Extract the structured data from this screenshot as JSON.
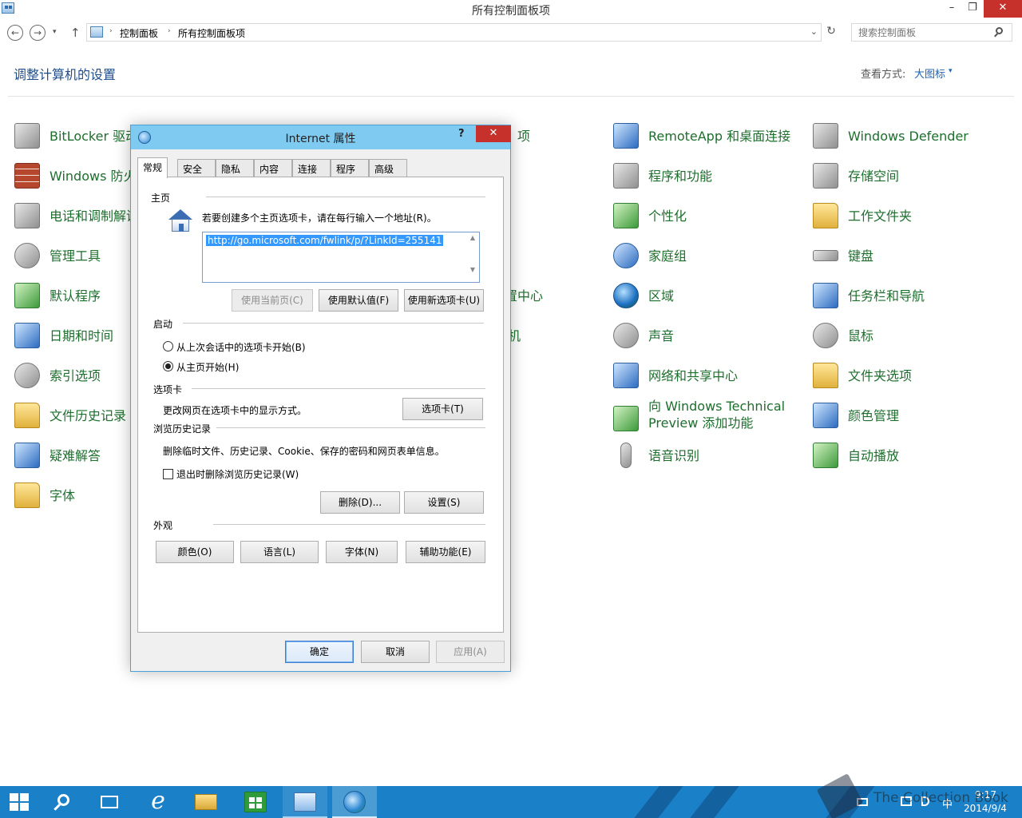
{
  "window": {
    "title": "所有控制面板项",
    "minimize": "–",
    "maximize": "❐",
    "close": "✕"
  },
  "nav": {
    "back": "←",
    "forward": "→",
    "history": "▾",
    "up": "↑",
    "breadcrumbs": [
      "控制面板",
      "所有控制面板项"
    ],
    "separator": "›",
    "address_dropdown": "⌄",
    "refresh": "↻",
    "search_placeholder": "搜索控制面板"
  },
  "header": {
    "title": "调整计算机的设置",
    "view_label": "查看方式:",
    "view_value": "大图标",
    "view_caret": "▾"
  },
  "items": {
    "col1": [
      "BitLocker 驱动",
      "Windows 防火",
      "电话和调制解调",
      "管理工具",
      "默认程序",
      "日期和时间",
      "索引选项",
      "文件历史记录",
      "疑难解答",
      "字体"
    ],
    "col2": [
      "项",
      "置中心",
      "机"
    ],
    "col3": [
      "RemoteApp 和桌面连接",
      "程序和功能",
      "个性化",
      "家庭组",
      "区域",
      "声音",
      "网络和共享中心",
      "向 Windows Technical",
      "Preview 添加功能",
      "语音识别"
    ],
    "col4": [
      "Windows Defender",
      "存储空间",
      "工作文件夹",
      "键盘",
      "任务栏和导航",
      "鼠标",
      "文件夹选项",
      "颜色管理",
      "自动播放"
    ]
  },
  "dialog": {
    "title": "Internet 属性",
    "help": "?",
    "close": "✕",
    "tabs": [
      "常规",
      "安全",
      "隐私",
      "内容",
      "连接",
      "程序",
      "高级"
    ],
    "home": {
      "label": "主页",
      "hint": "若要创建多个主页选项卡，请在每行输入一个地址(R)。",
      "url": "http://go.microsoft.com/fwlink/p/?LinkId=255141",
      "scroll_up": "▲",
      "scroll_down": "▼",
      "btn_current": "使用当前页(C)",
      "btn_default": "使用默认值(F)",
      "btn_newtab": "使用新选项卡(U)"
    },
    "startup": {
      "label": "启动",
      "opt1": "从上次会话中的选项卡开始(B)",
      "opt2": "从主页开始(H)",
      "selected": "opt2"
    },
    "tabs_section": {
      "label": "选项卡",
      "text": "更改网页在选项卡中的显示方式。",
      "btn": "选项卡(T)"
    },
    "history": {
      "label": "浏览历史记录",
      "text": "删除临时文件、历史记录、Cookie、保存的密码和网页表单信息。",
      "checkbox": "退出时删除浏览历史记录(W)",
      "checked": false,
      "btn_delete": "删除(D)...",
      "btn_settings": "设置(S)"
    },
    "appearance": {
      "label": "外观",
      "btn_colors": "颜色(O)",
      "btn_languages": "语言(L)",
      "btn_fonts": "字体(N)",
      "btn_accessibility": "辅助功能(E)"
    },
    "footer": {
      "ok": "确定",
      "cancel": "取消",
      "apply": "应用(A)"
    }
  },
  "taskbar": {
    "time": "9:17",
    "date": "2014/9/4",
    "ime": "中",
    "watermark": "The Collection Book"
  },
  "colors": {
    "taskbar": "#1a80c8",
    "dialog_title": "#7fcaf0",
    "close_red": "#c7312b",
    "item_green": "#1e6e2e",
    "link_blue": "#1e4e8c"
  }
}
